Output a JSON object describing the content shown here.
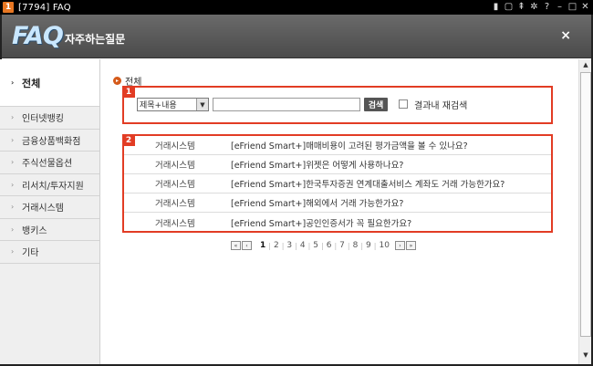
{
  "window": {
    "badge": "1",
    "title": "[7794] FAQ",
    "icons": [
      "plug-icon",
      "window-icon",
      "pin-icon",
      "settings-icon",
      "help-icon",
      "minimize-icon",
      "maximize-icon",
      "close-icon"
    ]
  },
  "header": {
    "logo": "FAQ",
    "subtitle": "자주하는질문",
    "close": "×"
  },
  "sidebar": {
    "items": [
      {
        "label": "전체",
        "active": true
      },
      {
        "label": "인터넷뱅킹"
      },
      {
        "label": "금융상품백화점"
      },
      {
        "label": "주식선물옵션"
      },
      {
        "label": "리서치/투자지원"
      },
      {
        "label": "거래시스템"
      },
      {
        "label": "뱅키스"
      },
      {
        "label": "기타"
      }
    ]
  },
  "main": {
    "section_title": "전체",
    "search": {
      "badge": "1",
      "select_value": "제목+내용",
      "input_value": "",
      "button_label": "검색",
      "within_label": "결과내 재검색",
      "within_checked": false
    },
    "list": {
      "badge": "2",
      "rows": [
        {
          "category": "거래시스템",
          "title": "[eFriend Smart+]매매비용이 고려된 평가금액을 볼 수 있나요?"
        },
        {
          "category": "거래시스템",
          "title": "[eFriend Smart+]위젯은 어떻게 사용하나요?"
        },
        {
          "category": "거래시스템",
          "title": "[eFriend Smart+]한국투자증권 연계대출서비스 계좌도 거래 가능한가요?"
        },
        {
          "category": "거래시스템",
          "title": "[eFriend Smart+]해외에서 거래 가능한가요?"
        },
        {
          "category": "거래시스템",
          "title": "[eFriend Smart+]공인인증서가 꼭 필요한가요?"
        }
      ]
    },
    "pager": {
      "first": "«",
      "prev": "‹",
      "next": "›",
      "last": "»",
      "pages": [
        "1",
        "2",
        "3",
        "4",
        "5",
        "6",
        "7",
        "8",
        "9",
        "10"
      ],
      "current": "1"
    }
  },
  "colors": {
    "accent_red": "#e23c24",
    "header_bg": "#555555",
    "sidebar_bg": "#efefef"
  }
}
